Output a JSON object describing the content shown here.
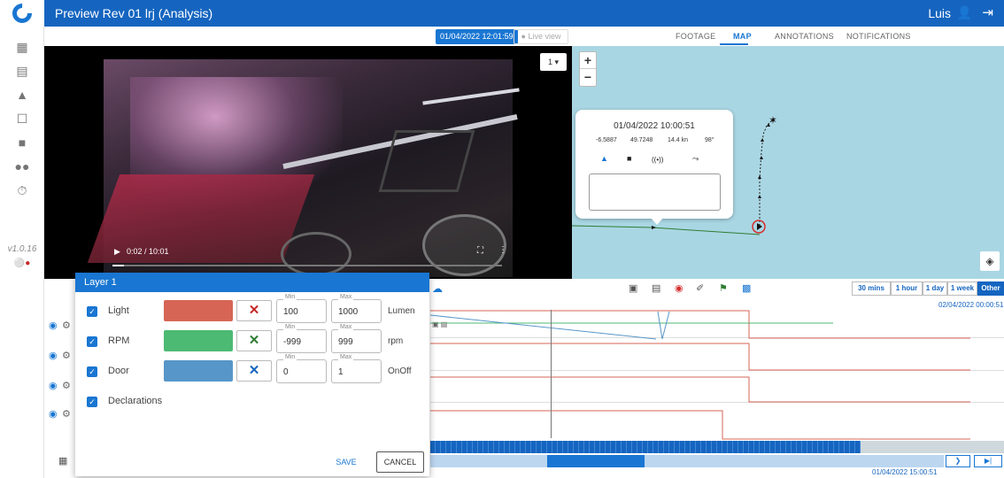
{
  "app": {
    "title": "Preview Rev 01 lrj (Analysis)",
    "user": "Luis",
    "version": "v1.0.16"
  },
  "toolbar": {
    "datetime": "01/04/2022 12:01:59",
    "live_label": "Live view"
  },
  "tabs": [
    {
      "label": "FOOTAGE",
      "active": false
    },
    {
      "label": "MAP",
      "active": true
    },
    {
      "label": "ANNOTATIONS",
      "active": false
    },
    {
      "label": "NOTIFICATIONS",
      "active": false
    }
  ],
  "video": {
    "time": "0:02 / 10:01",
    "camera": "1",
    "progress": 0.03
  },
  "map": {
    "popup": {
      "date": "01/04/2022 10:00:51",
      "values": [
        "-6.5887",
        "49.7248",
        "14.4 kn",
        "98°"
      ]
    },
    "zoom_in": "+",
    "zoom_out": "−"
  },
  "timeline": {
    "ranges": [
      {
        "label": "30 mins",
        "active": false
      },
      {
        "label": "1 hour",
        "active": false
      },
      {
        "label": "1 day",
        "active": false
      },
      {
        "label": "1 week",
        "active": false
      },
      {
        "label": "Other",
        "active": true
      }
    ],
    "start_date": "02/04/2022 00:00:51",
    "end_date": "01/04/2022 15:00:51"
  },
  "layer_panel": {
    "title": "Layer 1",
    "layers": [
      {
        "name": "Light",
        "color": "#d66556",
        "min_label": "Min",
        "min": "100",
        "max_label": "Max",
        "max": "1000",
        "unit": "Lumen",
        "x_color": "#c62828"
      },
      {
        "name": "RPM",
        "color": "#4cba73",
        "min_label": "Min",
        "min": "-999",
        "max_label": "Max",
        "max": "999",
        "unit": "rpm",
        "x_color": "#2e7d32"
      },
      {
        "name": "Door",
        "color": "#5796c9",
        "min_label": "Min",
        "min": "0",
        "max_label": "Max",
        "max": "1",
        "unit": "OnOff",
        "x_color": "#1565c0"
      },
      {
        "name": "Declarations"
      }
    ],
    "save_label": "SAVE",
    "cancel_label": "CANCEL"
  }
}
